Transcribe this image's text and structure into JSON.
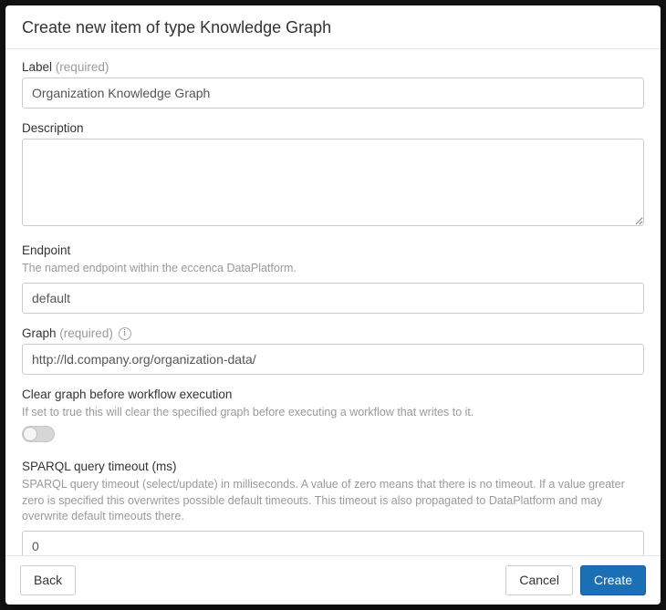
{
  "dialog": {
    "title": "Create new item of type Knowledge Graph",
    "fields": {
      "label": {
        "label": "Label",
        "required_hint": "(required)",
        "value": "Organization Knowledge Graph"
      },
      "description": {
        "label": "Description",
        "value": ""
      },
      "endpoint": {
        "label": "Endpoint",
        "help": "The named endpoint within the eccenca DataPlatform.",
        "value": "default"
      },
      "graph": {
        "label": "Graph",
        "required_hint": "(required)",
        "value": "http://ld.company.org/organization-data/"
      },
      "clear_graph": {
        "label": "Clear graph before workflow execution",
        "help": "If set to true this will clear the specified graph before executing a workflow that writes to it.",
        "value": false
      },
      "query_timeout": {
        "label": "SPARQL query timeout (ms)",
        "help": "SPARQL query timeout (select/update) in milliseconds. A value of zero means that there is no timeout. If a value greater zero is specified this overwrites possible default timeouts. This timeout is also propagated to DataPlatform and may overwrite default timeouts there.",
        "value": "0"
      }
    },
    "footer": {
      "back": "Back",
      "cancel": "Cancel",
      "create": "Create"
    }
  }
}
